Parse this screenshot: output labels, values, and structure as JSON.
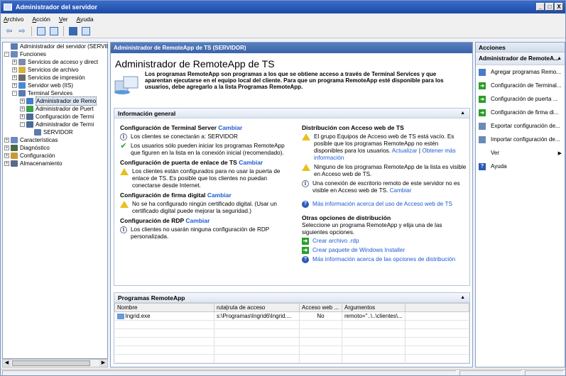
{
  "window": {
    "title": "Administrador del servidor",
    "controls": [
      "_",
      "□",
      "X"
    ]
  },
  "menu": [
    "Archivo",
    "Acción",
    "Ver",
    "Ayuda"
  ],
  "tree": [
    {
      "label": "Administrador del servidor (SERVID",
      "level": 0,
      "exp": "",
      "icon": "#5a7ab0"
    },
    {
      "label": "Funciones",
      "level": 0,
      "exp": "−",
      "icon": "#6a8ac0"
    },
    {
      "label": "Servicios de acceso y direct",
      "level": 1,
      "exp": "+",
      "icon": "#7a8ca8"
    },
    {
      "label": "Servicios de archivo",
      "level": 1,
      "exp": "+",
      "icon": "#d8b040"
    },
    {
      "label": "Servicios de impresión",
      "level": 1,
      "exp": "+",
      "icon": "#6a6a6a"
    },
    {
      "label": "Servidor web (IIS)",
      "level": 1,
      "exp": "+",
      "icon": "#4a8ad0"
    },
    {
      "label": "Terminal Services",
      "level": 1,
      "exp": "−",
      "icon": "#5a7ab0"
    },
    {
      "label": "Administrador de Remo",
      "level": 2,
      "exp": "+",
      "icon": "#4a7ac8",
      "selected": true
    },
    {
      "label": "Administrador de Puert",
      "level": 2,
      "exp": "+",
      "icon": "#3aa04a"
    },
    {
      "label": "Configuración de Termi",
      "level": 2,
      "exp": "+",
      "icon": "#4a6a98"
    },
    {
      "label": "Administrador de Termi",
      "level": 2,
      "exp": "−",
      "icon": "#4a6a98"
    },
    {
      "label": "SERVIDOR",
      "level": 3,
      "exp": "",
      "icon": "#5a7ab0"
    },
    {
      "label": "Características",
      "level": 0,
      "exp": "+",
      "icon": "#6a8ac0"
    },
    {
      "label": "Diagnóstico",
      "level": 0,
      "exp": "+",
      "icon": "#4a6a4a"
    },
    {
      "label": "Configuración",
      "level": 0,
      "exp": "+",
      "icon": "#c89a30"
    },
    {
      "label": "Almacenamiento",
      "level": 0,
      "exp": "+",
      "icon": "#5a6a8a"
    }
  ],
  "center": {
    "header": "Administrador de RemoteApp de TS (SERVIDOR)",
    "title": "Administrador de RemoteApp de TS",
    "intro": "Los programas RemoteApp son programas a los que se obtiene acceso a través de Terminal Services y que aparentan ejecutarse en el equipo local del cliente. Para que un programa RemoteApp esté disponible para los usuarios, debe agregarlo a la lista Programas RemoteApp.",
    "overview": {
      "title": "Información general",
      "ts_config": {
        "label": "Configuración de Terminal Server",
        "link": "Cambiar",
        "items": [
          {
            "icon": "info",
            "text": "Los clientes se conectarán a: SERVIDOR"
          },
          {
            "icon": "ok",
            "text": "Los usuarios sólo pueden iniciar los programas RemoteApp que figuren en la lista en la conexión inicial (recomendado)."
          }
        ]
      },
      "gateway": {
        "label": "Configuración de puerta de enlace de TS",
        "link": "Cambiar",
        "items": [
          {
            "icon": "warn",
            "text": "Los clientes están configurados para no usar la puerta de enlace de TS. Es posible que los clientes no puedan conectarse desde Internet."
          }
        ]
      },
      "signing": {
        "label": "Configuración de firma digital",
        "link": "Cambiar",
        "items": [
          {
            "icon": "warn",
            "text": "No se ha configurado ningún certificado digital. (Usar un certificado digital puede mejorar la seguridad.)"
          }
        ]
      },
      "rdp": {
        "label": "Configuración de RDP",
        "link": "Cambiar",
        "items": [
          {
            "icon": "info",
            "text": "Los clientes no usarán ninguna configuración de RDP personalizada."
          }
        ]
      },
      "web": {
        "label": "Distribución con Acceso web de TS",
        "item1_text": "El grupo Equipos de Acceso web de TS está vacío. Es posible que los programas RemoteApp no estén disponibles para los usuarios.",
        "item1_link_a": "Actualizar",
        "item1_sep": " | ",
        "item1_link_b": "Obtener más información",
        "item2_text": "Ninguno de los programas RemoteApp de la lista es visible en Acceso web de TS.",
        "item3_text": "Una conexión de escritorio remoto de este servidor no es visible en Acceso web de TS.",
        "item3_link": "Cambiar",
        "help_link": "Más información acerca del uso de Acceso web de TS"
      },
      "distribution": {
        "label": "Otras opciones de distribución",
        "text": "Seleccione un programa RemoteApp y elija una de las siguientes opciones.",
        "link_rdp": "Crear archivo .rdp",
        "link_msi": "Crear paquete de Windows Installer",
        "help_link": "Más información acerca de las opciones de distribución"
      }
    },
    "programs": {
      "title": "Programas RemoteApp",
      "columns": [
        "Nombre",
        "ruta|ruta de acceso",
        "Acceso web ...",
        "Argumentos"
      ],
      "rows": [
        [
          "Ingrid.exe",
          "s:\\Programas\\Ingrid6\\Ingrid....",
          "No",
          "remoto=\"..\\..\\clientes\\..."
        ]
      ]
    }
  },
  "actions": {
    "title": "Acciones",
    "subtitle": "Administrador de RemoteA...",
    "items": [
      {
        "label": "Agregar programas Remo...",
        "icon": "add-programs-icon",
        "color": "#4a7ac8"
      },
      {
        "label": "Configuración de Terminal...",
        "icon": "arrow-right-icon",
        "color": "#28a028"
      },
      {
        "label": "Configuración de puerta ...",
        "icon": "arrow-right-icon",
        "color": "#28a028"
      },
      {
        "label": "Configuración de firma di...",
        "icon": "arrow-right-icon",
        "color": "#28a028"
      },
      {
        "label": "Exportar configuración de...",
        "icon": "export-icon",
        "color": "#6a8ab8"
      },
      {
        "label": "Importar configuración de...",
        "icon": "import-icon",
        "color": "#6a8ab8"
      },
      {
        "label": "Ver",
        "icon": "",
        "color": "",
        "submenu": true
      },
      {
        "label": "Ayuda",
        "icon": "help-icon",
        "color": "#2a5ab8"
      }
    ]
  }
}
